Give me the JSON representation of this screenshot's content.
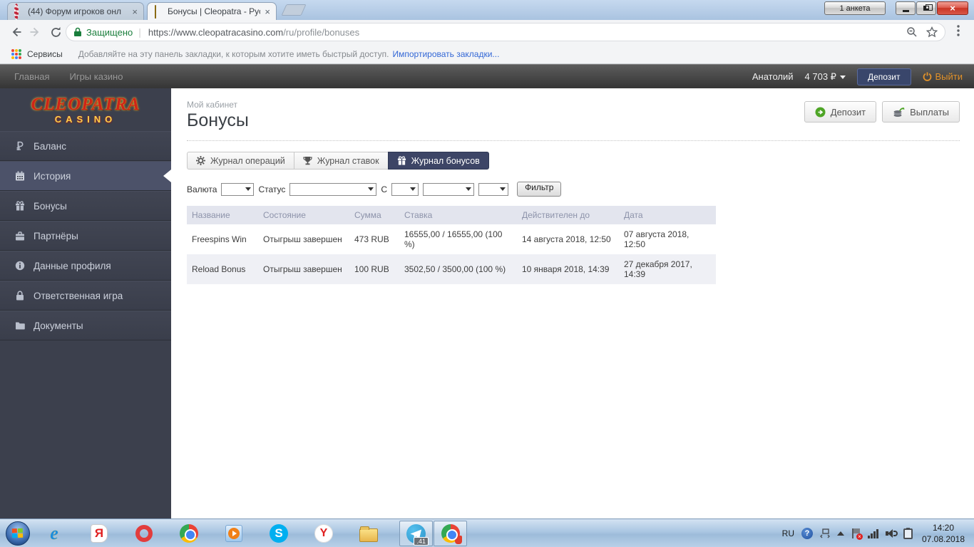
{
  "window": {
    "tabs": [
      {
        "icon": "casino-chip-icon",
        "title": "(44) Форум игроков онл",
        "close": "×"
      },
      {
        "icon": "cleopatra-icon",
        "title": "Бонусы | Cleopatra - Рус",
        "close": "×"
      }
    ],
    "anketa_button": "1 анкета",
    "close_glyph": "×"
  },
  "browser": {
    "security_label": "Защищено",
    "url_domain": "https://www.cleopatracasino.com",
    "url_path": "/ru/profile/bonuses",
    "bookmarks_label": "Сервисы",
    "bookmarks_hint": "Добавляйте на эту панель закладки, к которым хотите иметь быстрый доступ.",
    "bookmarks_import_link": "Импортировать закладки..."
  },
  "site": {
    "nav": {
      "links": [
        {
          "label": "Главная"
        },
        {
          "label": "Игры казино"
        }
      ],
      "username": "Анатолий",
      "balance": "4 703 ₽",
      "deposit_button": "Депозит",
      "logout_button": "Выйти"
    },
    "logo": {
      "line1": "CLEOPATRA",
      "line2": "CASINO"
    },
    "sidebar": [
      {
        "icon": "ruble-icon",
        "label": "Баланс"
      },
      {
        "icon": "calendar-icon",
        "label": "История"
      },
      {
        "icon": "gift-icon",
        "label": "Бонусы"
      },
      {
        "icon": "briefcase-icon",
        "label": "Партнёры"
      },
      {
        "icon": "info-icon",
        "label": "Данные профиля"
      },
      {
        "icon": "lock-icon",
        "label": "Ответственная игра"
      },
      {
        "icon": "folder-icon",
        "label": "Документы"
      }
    ],
    "page": {
      "breadcrumb": "Мой кабинет",
      "title": "Бонусы",
      "deposit_button": "Депозит",
      "payout_button": "Выплаты",
      "tabs": [
        {
          "icon": "gear-icon",
          "label": "Журнал операций"
        },
        {
          "icon": "trophy-icon",
          "label": "Журнал ставок"
        },
        {
          "icon": "gift-icon",
          "label": "Журнал бонусов"
        }
      ],
      "filters": {
        "currency_label": "Валюта",
        "status_label": "Статус",
        "from_label": "С",
        "filter_button": "Фильтр"
      },
      "table": {
        "headers": [
          "Название",
          "Состояние",
          "Сумма",
          "Ставка",
          "Действителен до",
          "Дата"
        ],
        "rows": [
          [
            "Freespins Win",
            "Отыгрыш завершен",
            "473 RUB",
            "16555,00 / 16555,00 (100 %)",
            "14 августа 2018, 12:50",
            "07 августа 2018, 12:50"
          ],
          [
            "Reload Bonus",
            "Отыгрыш завершен",
            "100 RUB",
            "3502,50 / 3500,00 (100 %)",
            "10 января 2018, 14:39",
            "27 декабря 2017, 14:39"
          ]
        ]
      }
    }
  },
  "taskbar": {
    "telegram_badge": ".41",
    "tray": {
      "language": "RU",
      "time": "14:20",
      "date": "07.08.2018"
    }
  },
  "colors": {
    "accent_indigo": "#3d4566",
    "accent_orange": "#e0912a",
    "secure_green": "#188038",
    "sidebar_bg": "#3c404d",
    "active_item": "#4c5269",
    "taskbar_blue": "#aac6e2"
  }
}
